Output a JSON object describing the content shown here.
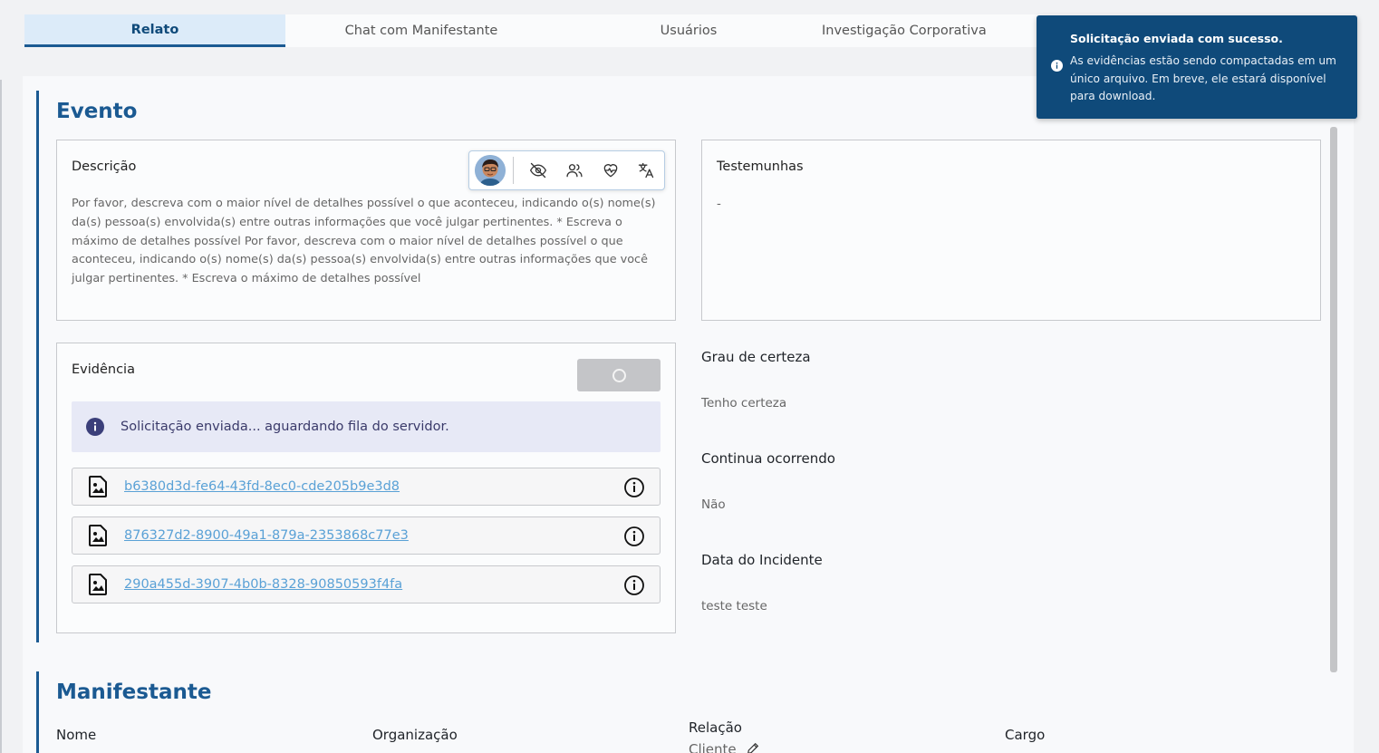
{
  "tabs": [
    {
      "label": "Relato",
      "active": true
    },
    {
      "label": "Chat com Manifestante",
      "active": false
    },
    {
      "label": "Usuários",
      "active": false
    },
    {
      "label": "Investigação Corporativa",
      "active": false
    }
  ],
  "evento": {
    "title": "Evento",
    "descricao": {
      "label": "Descrição",
      "text": "Por favor, descreva com o maior nível de detalhes possível o que aconteceu, indicando o(s) nome(s) da(s) pessoa(s) envolvida(s) entre outras informações que você julgar pertinentes. * Escreva o máximo de detalhes possível Por favor, descreva com o maior nível de detalhes possível o que aconteceu, indicando o(s) nome(s) da(s) pessoa(s) envolvida(s) entre outras informações que você julgar pertinentes. * Escreva o máximo de detalhes possível",
      "toolbar_icons": [
        "avatar",
        "eye-off-icon",
        "users-icon",
        "heart-pulse-icon",
        "translate-icon"
      ]
    },
    "testemunhas": {
      "label": "Testemunhas",
      "value": "-"
    },
    "evidencia": {
      "label": "Evidência",
      "info": "Solicitação enviada... aguardando fila do servidor.",
      "files": [
        "b6380d3d-fe64-43fd-8ec0-cde205b9e3d8",
        "876327d2-8900-49a1-879a-2353868c77e3",
        "290a455d-3907-4b0b-8328-90850593f4fa"
      ]
    },
    "grau_certeza": {
      "label": "Grau de certeza",
      "value": "Tenho certeza"
    },
    "continua": {
      "label": "Continua ocorrendo",
      "value": "Não"
    },
    "data_incidente": {
      "label": "Data do Incidente",
      "value": "teste teste"
    }
  },
  "manifestante": {
    "title": "Manifestante",
    "nome_label": "Nome",
    "organizacao_label": "Organização",
    "relacao_label": "Relação",
    "relacao_value": "Cliente",
    "cargo_label": "Cargo"
  },
  "toast": {
    "title": "Solicitação enviada com sucesso.",
    "body": "As evidências estão sendo compactadas em um único arquivo. Em breve, ele estará disponível para download."
  },
  "colors": {
    "primary": "#1b5a92",
    "toast_bg": "#0f4a7a",
    "link": "#5aa1d6",
    "info_bg": "#e7e9f6"
  }
}
